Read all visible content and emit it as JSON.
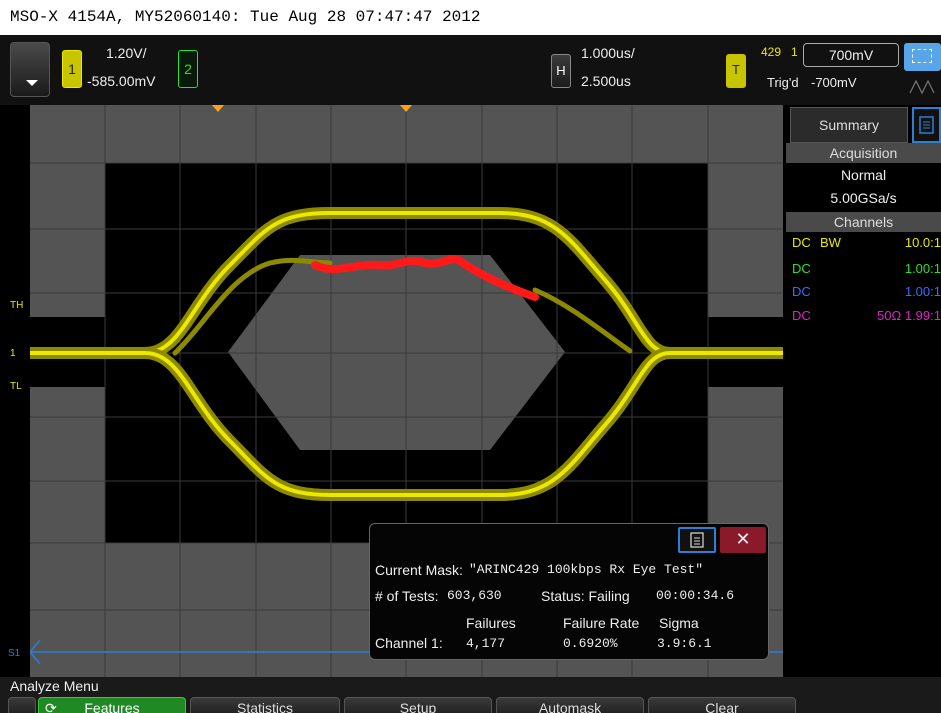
{
  "title_bar": "MSO-X 4154A, MY52060140: Tue Aug 28 07:47:47 2012",
  "top_bar": {
    "ch1_label": "1",
    "ch1_scale": "1.20V/",
    "ch1_offset": "-585.00mV",
    "ch2_label": "2",
    "h_label": "H",
    "time_scale": "1.000us/",
    "time_delay": "2.500us",
    "t_label": "T",
    "trig_mode": "429",
    "trig_source": "1",
    "trig_status": "Trig'd",
    "trig_level_high": "700mV",
    "trig_level_low": "-700mV"
  },
  "side_panel": {
    "tab_summary": "Summary",
    "acquisition_header": "Acquisition",
    "acq_mode": "Normal",
    "sample_rate": "5.00GSa/s",
    "channels_header": "Channels",
    "channels": [
      {
        "coupling": "DC",
        "extra": "BW",
        "ratio": "10.0:1",
        "color": "#ece800"
      },
      {
        "coupling": "DC",
        "extra": "",
        "ratio": "1.00:1",
        "color": "#2ee02e"
      },
      {
        "coupling": "DC",
        "extra": "",
        "ratio": "1.00:1",
        "color": "#3a6cff"
      },
      {
        "coupling": "DC",
        "extra": "50Ω",
        "ratio": "1.99:1",
        "color": "#e020c8"
      }
    ]
  },
  "mask_panel": {
    "current_mask_label": "Current Mask:",
    "current_mask_value": "\"ARINC429 100kbps Rx Eye Test\"",
    "tests_label": "# of Tests:",
    "tests_value": "603,630",
    "status_label": "Status: Failing",
    "elapsed": "00:00:34.6",
    "col_failures": "Failures",
    "col_failure_rate": "Failure Rate",
    "col_sigma": "Sigma",
    "row_label": "Channel 1:",
    "failures_value": "4,177",
    "failure_rate_value": "0.6920%",
    "sigma_value": "3.9:6.1"
  },
  "markers": {
    "th": "TH",
    "one": "1",
    "tl": "TL",
    "s1": "S1"
  },
  "menu": {
    "title": "Analyze Menu",
    "softkeys": [
      "Features",
      "Statistics",
      "Setup",
      "Automask",
      "Clear"
    ]
  },
  "colors": {
    "ch1": "#ece800",
    "failure": "#ff1a1a",
    "mask": "#5a5a5a",
    "accent_blue": "#2d7fd4"
  }
}
